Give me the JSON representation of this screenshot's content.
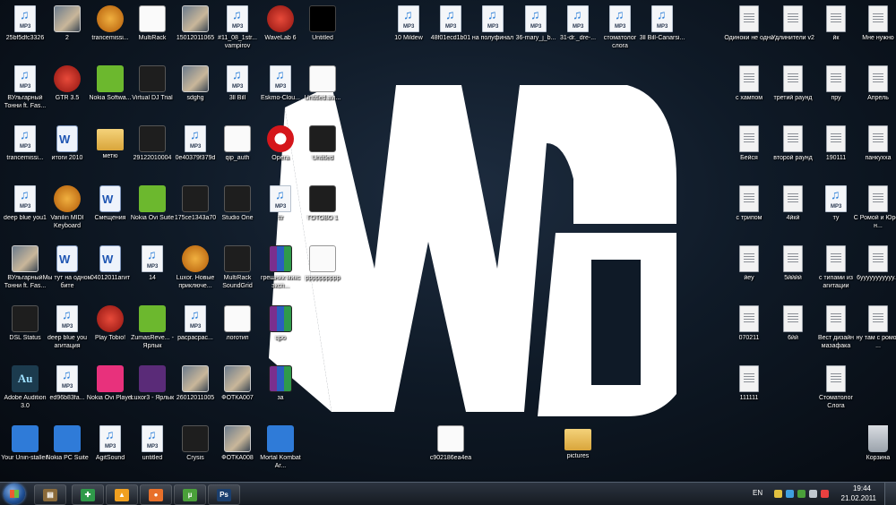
{
  "desktop": {
    "icons": [
      {
        "label": "25bf5dfc3326",
        "type": "mp3"
      },
      {
        "label": "2",
        "type": "photo"
      },
      {
        "label": "trancemissi...",
        "type": "orange"
      },
      {
        "label": "MultiRack",
        "type": "white"
      },
      {
        "label": "15012011065",
        "type": "photo"
      },
      {
        "label": "#11_08_1str... vampirov",
        "type": "mp3"
      },
      {
        "label": "WaveLab 6",
        "type": "red"
      },
      {
        "label": "Untitled",
        "type": "black"
      },
      {
        "label": "10 Mildew",
        "type": "mp3"
      },
      {
        "label": "48f01ecd1b01",
        "type": "mp3"
      },
      {
        "label": "на полуфинал",
        "type": "mp3"
      },
      {
        "label": "36-mary_j_b...",
        "type": "mp3"
      },
      {
        "label": "31-dr._dre-...",
        "type": "mp3"
      },
      {
        "label": "стоматолог слога",
        "type": "mp3"
      },
      {
        "label": "3ll Bill-Canarsi...",
        "type": "mp3"
      },
      {
        "label": "Одиноки не одни",
        "type": "txt"
      },
      {
        "label": "Удлинители v2",
        "type": "txt"
      },
      {
        "label": "йк",
        "type": "txt"
      },
      {
        "label": "Мне нужно",
        "type": "txt"
      },
      {
        "label": "ВУльгарный Тонни ft. Fas...",
        "type": "mp3"
      },
      {
        "label": "GTR 3.5",
        "type": "red"
      },
      {
        "label": "Nokia Softwa...",
        "type": "green"
      },
      {
        "label": "Virtual DJ Trial",
        "type": "dark"
      },
      {
        "label": "sdghg",
        "type": "photo"
      },
      {
        "label": "3ll Bill",
        "type": "mp3"
      },
      {
        "label": "Eskmo-Clou...",
        "type": "mp3"
      },
      {
        "label": "Untitled.avi...",
        "type": "white"
      },
      {
        "label": "с хампом",
        "type": "txt"
      },
      {
        "label": "третий раунд",
        "type": "txt"
      },
      {
        "label": "пру",
        "type": "txt"
      },
      {
        "label": "Апрель",
        "type": "txt"
      },
      {
        "label": "trancemissi...",
        "type": "mp3"
      },
      {
        "label": "итоги 2010",
        "type": "doc"
      },
      {
        "label": "метю",
        "type": "folder"
      },
      {
        "label": "29122010004",
        "type": "dark"
      },
      {
        "label": "0e40379f379d",
        "type": "mp3"
      },
      {
        "label": "qip_auth",
        "type": "white"
      },
      {
        "label": "Opera",
        "type": "opera"
      },
      {
        "label": "Untitled",
        "type": "dark"
      },
      {
        "label": "Бейся",
        "type": "txt"
      },
      {
        "label": "второй раунд",
        "type": "txt"
      },
      {
        "label": "190111",
        "type": "txt"
      },
      {
        "label": "панкухха",
        "type": "txt"
      },
      {
        "label": "deep blue you1",
        "type": "mp3"
      },
      {
        "label": "Vanilin MIDI Keyboard",
        "type": "orange"
      },
      {
        "label": "Смещения",
        "type": "doc"
      },
      {
        "label": "Nokia Ovi Suite",
        "type": "green"
      },
      {
        "label": "175ce1343a70",
        "type": "dark"
      },
      {
        "label": "Studio One",
        "type": "dark"
      },
      {
        "label": "ttr",
        "type": "mp3"
      },
      {
        "label": "ГОТОВО 1",
        "type": "dark"
      },
      {
        "label": "с трипом",
        "type": "txt"
      },
      {
        "label": "4йкй",
        "type": "txt"
      },
      {
        "label": "ту",
        "type": "mp3"
      },
      {
        "label": "С Ромой и Юрой н...",
        "type": "txt"
      },
      {
        "label": "ВУльгарный Тонни ft. Fas...",
        "type": "photo"
      },
      {
        "label": "Мы тут на одном бите",
        "type": "doc"
      },
      {
        "label": "04012011агит",
        "type": "doc"
      },
      {
        "label": "14",
        "type": "mp3"
      },
      {
        "label": "Luxor. Новые приключе...",
        "type": "orange"
      },
      {
        "label": "MultiRack SoundGrid",
        "type": "dark"
      },
      {
        "label": "грешник микс эксп...",
        "type": "rar"
      },
      {
        "label": "рррррррррр",
        "type": "white"
      },
      {
        "label": "йеу",
        "type": "txt"
      },
      {
        "label": "5йййй",
        "type": "txt"
      },
      {
        "label": "с типами из агитации",
        "type": "txt"
      },
      {
        "label": "6yyyyyyyyyyy...",
        "type": "txt"
      },
      {
        "label": "DSL Status",
        "type": "dark"
      },
      {
        "label": "deep blue you агитация",
        "type": "mp3"
      },
      {
        "label": "Play Tobio!",
        "type": "red"
      },
      {
        "label": "ZumasReve... - Ярлык",
        "type": "green"
      },
      {
        "label": "расрасрас...",
        "type": "mp3"
      },
      {
        "label": "логотип",
        "type": "white"
      },
      {
        "label": "цро",
        "type": "rar"
      },
      {
        "label": "070211",
        "type": "txt"
      },
      {
        "label": "6йй",
        "type": "txt"
      },
      {
        "label": "Вест дизайн мазафака",
        "type": "txt"
      },
      {
        "label": "ну там с ромой ...",
        "type": "txt"
      },
      {
        "label": "Adobe Audition 3.0",
        "type": "adobe"
      },
      {
        "label": "ed96b83fa...",
        "type": "mp3"
      },
      {
        "label": "Nokia Ovi Player",
        "type": "pink"
      },
      {
        "label": "Luxor3 - Ярлык",
        "type": "purple"
      },
      {
        "label": "26012011005",
        "type": "photo"
      },
      {
        "label": "ФОТКА007",
        "type": "photo"
      },
      {
        "label": "за",
        "type": "rar"
      },
      {
        "label": "111111",
        "type": "txt"
      },
      {
        "label": "Стоматолог Слога",
        "type": "txt"
      },
      {
        "label": "Your Unin-staller!",
        "type": "blue"
      },
      {
        "label": "Nokia PC Suite",
        "type": "blue"
      },
      {
        "label": "AgitSound",
        "type": "mp3"
      },
      {
        "label": "untitled",
        "type": "mp3"
      },
      {
        "label": "Crysis",
        "type": "dark"
      },
      {
        "label": "ФОТКА008",
        "type": "photo"
      },
      {
        "label": "Mortal Kombat Ar...",
        "type": "blue"
      },
      {
        "label": "c902186ea4ea",
        "type": "white"
      },
      {
        "label": "pictures",
        "type": "folder"
      },
      {
        "label": "Корзина",
        "type": "bin"
      }
    ]
  },
  "taskbar": {
    "buttons": [
      {
        "name": "file-manager",
        "glyph": "▤",
        "color": "#8a6a3a"
      },
      {
        "name": "tool",
        "glyph": "✚",
        "color": "#2f9a4a"
      },
      {
        "name": "aimp",
        "glyph": "▲",
        "color": "#f0a020"
      },
      {
        "name": "firefox",
        "glyph": "●",
        "color": "#e8702a"
      },
      {
        "name": "utorrent",
        "glyph": "µ",
        "color": "#4aa03a"
      },
      {
        "name": "photoshop",
        "glyph": "Ps",
        "color": "#1b3f6e"
      }
    ],
    "tray": {
      "language": "EN",
      "time": "19:44",
      "date": "21.02.2011"
    }
  }
}
